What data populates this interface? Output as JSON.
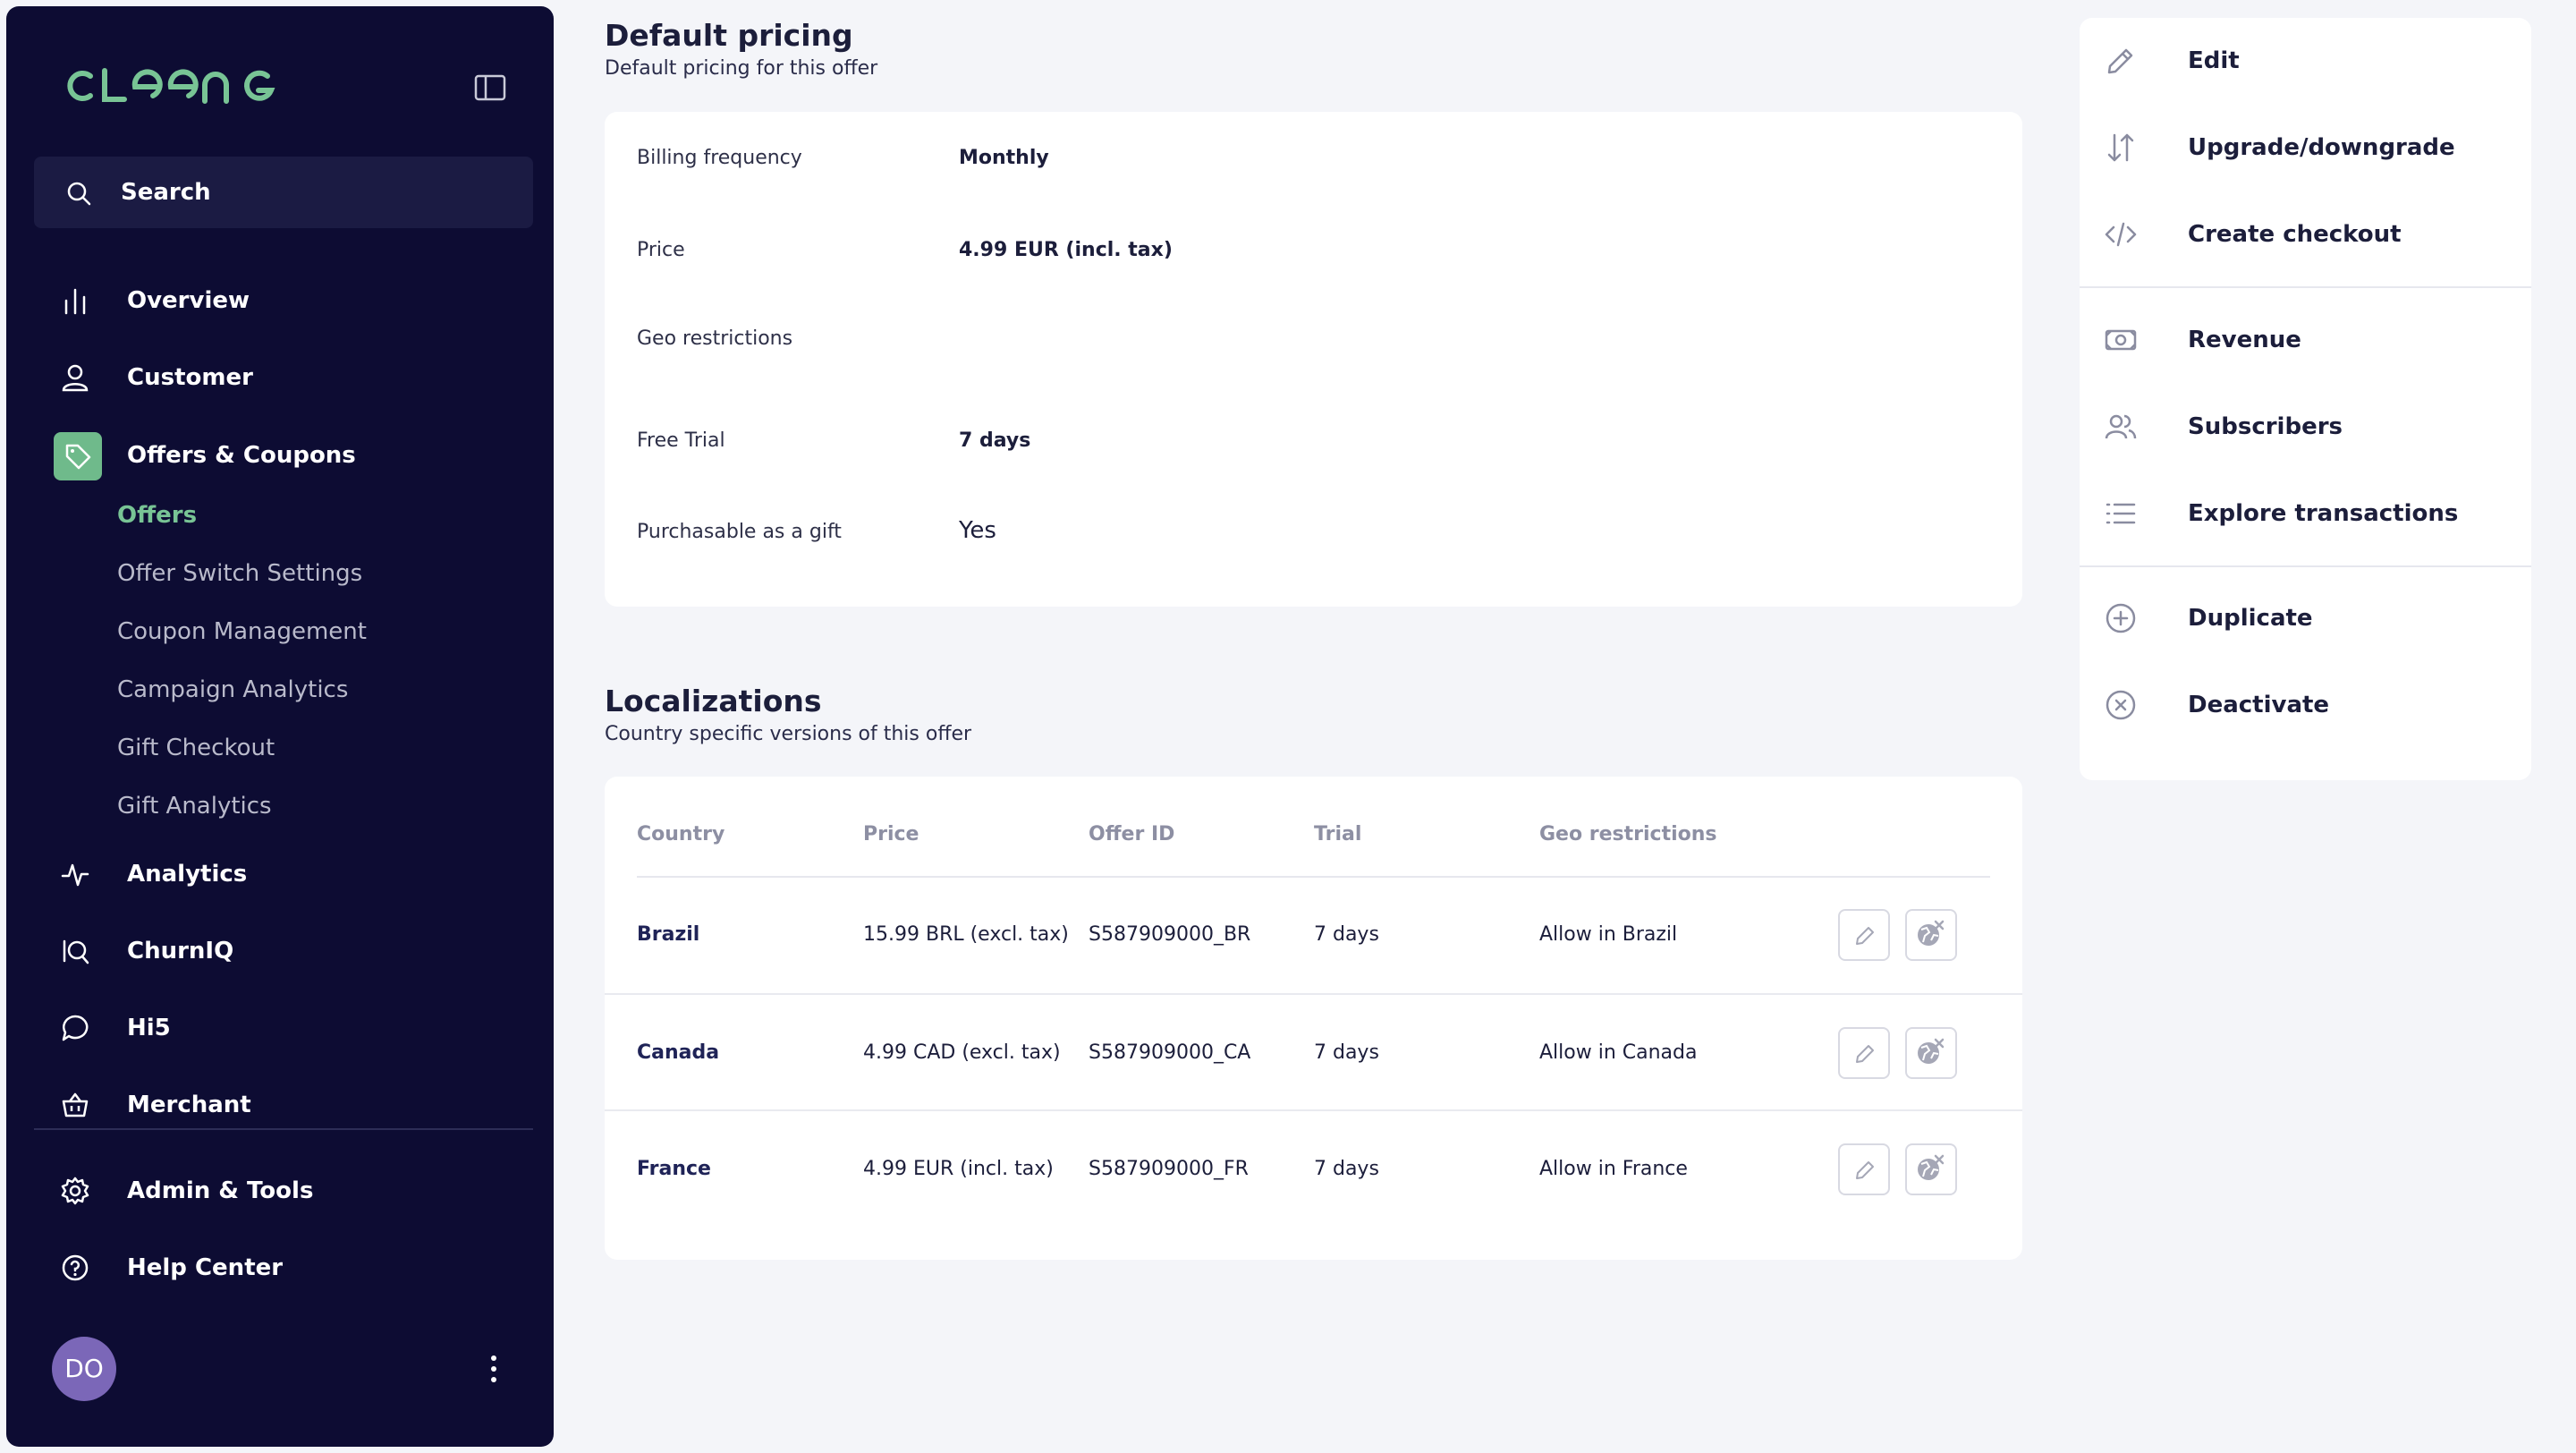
{
  "sidebar": {
    "logo": "CLEENG",
    "search_label": "Search",
    "nav": {
      "overview": "Overview",
      "customer": "Customer",
      "offers_coupons": "Offers & Coupons",
      "analytics": "Analytics",
      "churniq": "ChurnIQ",
      "hi5": "Hi5",
      "merchant": "Merchant",
      "admin_tools": "Admin & Tools",
      "help_center": "Help Center"
    },
    "sub_items": [
      "Offers",
      "Offer Switch Settings",
      "Coupon Management",
      "Campaign Analytics",
      "Gift Checkout",
      "Gift Analytics"
    ],
    "active_sub": "Offers",
    "avatar_initials": "DO",
    "accent_color": "#78c495"
  },
  "default_pricing": {
    "title": "Default pricing",
    "subtitle": "Default pricing for this offer",
    "fields": [
      {
        "label": "Billing frequency",
        "value": "Monthly"
      },
      {
        "label": "Price",
        "value": "4.99 EUR (incl. tax)"
      },
      {
        "label": "Geo restrictions",
        "value": ""
      },
      {
        "label": "Free Trial",
        "value": "7 days"
      },
      {
        "label": "Purchasable as a gift",
        "value": "Yes"
      }
    ]
  },
  "localizations": {
    "title": "Localizations",
    "subtitle": "Country specific versions of this offer",
    "columns": [
      "Country",
      "Price",
      "Offer ID",
      "Trial",
      "Geo restrictions"
    ],
    "rows": [
      {
        "country": "Brazil",
        "price": "15.99 BRL (excl. tax)",
        "offer_id": "S587909000_BR",
        "trial": "7 days",
        "geo": "Allow in Brazil"
      },
      {
        "country": "Canada",
        "price": "4.99 CAD (excl. tax)",
        "offer_id": "S587909000_CA",
        "trial": "7 days",
        "geo": "Allow in Canada"
      },
      {
        "country": "France",
        "price": "4.99 EUR (incl. tax)",
        "offer_id": "S587909000_FR",
        "trial": "7 days",
        "geo": "Allow in France"
      }
    ]
  },
  "actions": {
    "edit": "Edit",
    "upgrade": "Upgrade/downgrade",
    "checkout": "Create checkout",
    "revenue": "Revenue",
    "subscribers": "Subscribers",
    "transactions": "Explore transactions",
    "duplicate": "Duplicate",
    "deactivate": "Deactivate"
  },
  "icons": [
    "sidebar-collapse-icon",
    "search-icon",
    "bar-chart-icon",
    "user-icon",
    "tag-icon",
    "activity-icon",
    "churniq-icon",
    "chat-bubble-icon",
    "basket-icon",
    "gear-icon",
    "help-circle-icon",
    "more-vertical-icon",
    "pencil-icon",
    "arrows-up-down-icon",
    "code-icon",
    "banknote-icon",
    "users-icon",
    "list-icon",
    "plus-circle-icon",
    "x-circle-icon",
    "globe-off-icon"
  ]
}
